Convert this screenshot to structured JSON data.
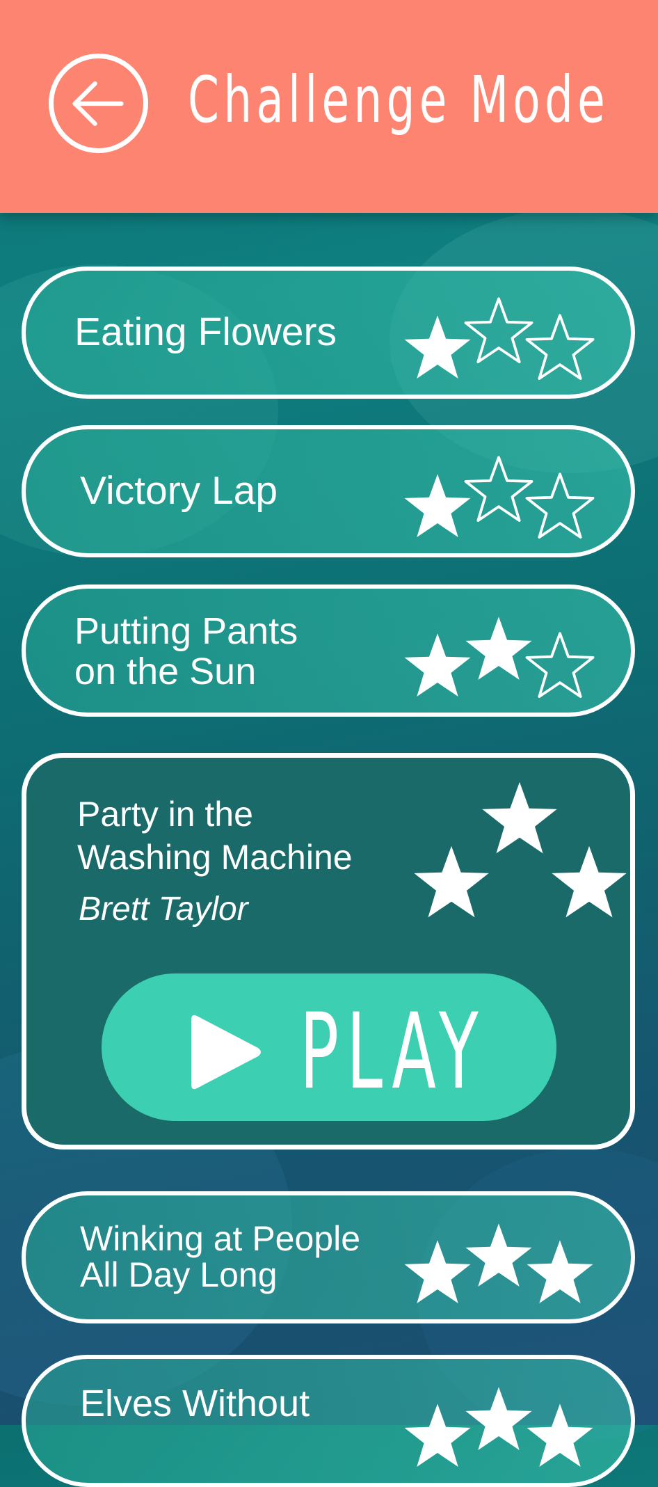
{
  "header": {
    "title": "Challenge Mode",
    "back_icon": "arrow-left-icon",
    "background": "#fd8470"
  },
  "challenges": [
    {
      "title_lines": [
        "Eating Flowers"
      ],
      "stars": 1,
      "max_stars": 3
    },
    {
      "title_lines": [
        "Victory Lap"
      ],
      "stars": 1,
      "max_stars": 3
    },
    {
      "title_lines": [
        "Putting Pants",
        "on the Sun"
      ],
      "stars": 2,
      "max_stars": 3
    },
    {
      "title_lines": [
        "Winking at People",
        "All Day Long"
      ],
      "stars": 3,
      "max_stars": 3
    },
    {
      "title_lines": [
        "Elves Without"
      ],
      "stars": 3,
      "max_stars": 3
    }
  ],
  "selected": {
    "title_lines": [
      "Party in the",
      "Washing Machine"
    ],
    "author": "Brett Taylor",
    "stars": 3,
    "max_stars": 3,
    "play_label": "PLAY",
    "play_icon": "play-icon",
    "play_color": "#3ccfb1"
  }
}
